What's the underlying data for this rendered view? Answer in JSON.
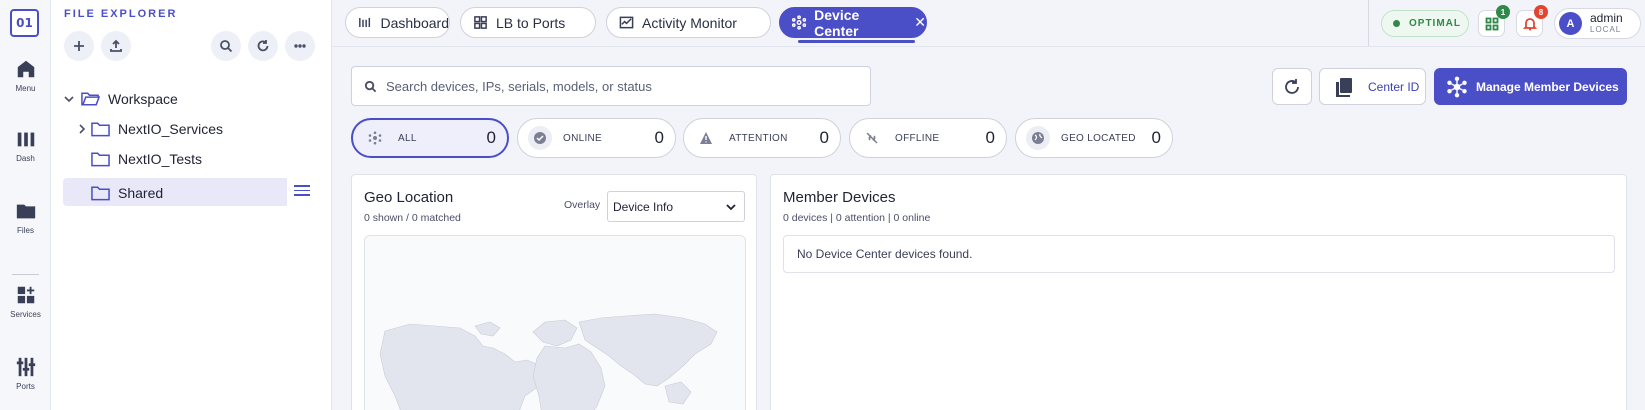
{
  "rail": {
    "logo": "01",
    "items": [
      {
        "label": "Menu",
        "icon": "home-icon"
      },
      {
        "label": "Dash",
        "icon": "bar-chart-icon"
      },
      {
        "label": "Files",
        "icon": "folder-icon"
      },
      {
        "label": "Services",
        "icon": "grid-plus-icon"
      },
      {
        "label": "Ports",
        "icon": "sliders-icon"
      }
    ]
  },
  "explorer": {
    "title": "FILE EXPLORER",
    "toolbar": [
      "plus-icon",
      "upload-icon",
      "search-icon",
      "refresh-icon",
      "more-icon"
    ],
    "tree": [
      {
        "label": "Workspace",
        "level": 0,
        "expanded": true
      },
      {
        "label": "NextIO_Services",
        "level": 1,
        "expanded": false
      },
      {
        "label": "NextIO_Tests",
        "level": 1
      },
      {
        "label": "Shared",
        "level": 1,
        "selected": true
      }
    ]
  },
  "tabs": [
    {
      "label": "Dashboard",
      "icon": "dashboard-icon"
    },
    {
      "label": "LB to Ports",
      "icon": "lb-icon"
    },
    {
      "label": "Activity Monitor",
      "icon": "activity-icon"
    },
    {
      "label": "Device Center",
      "icon": "device-hub-icon",
      "active": true,
      "close": "✕"
    }
  ],
  "header": {
    "status": "OPTIMAL",
    "apps_badge": "1",
    "notif_badge": "8",
    "user": {
      "initial": "A",
      "name": "admin",
      "role": "LOCAL"
    },
    "accent": "#4b4fc7",
    "status_color": "#2f8a49",
    "notif_color": "#e2452f"
  },
  "main": {
    "search_placeholder": "Search devices, IPs, serials, models, or status",
    "center_id_label": "Center ID",
    "manage_label": "Manage Member Devices",
    "filters": [
      {
        "label": "ALL",
        "count": "0",
        "icon": "hub-icon",
        "active": true
      },
      {
        "label": "ONLINE",
        "count": "0",
        "icon": "check-circle-icon"
      },
      {
        "label": "ATTENTION",
        "count": "0",
        "icon": "warning-icon"
      },
      {
        "label": "OFFLINE",
        "count": "0",
        "icon": "link-off-icon"
      },
      {
        "label": "GEO LOCATED",
        "count": "0",
        "icon": "globe-icon"
      }
    ],
    "geo": {
      "title": "Geo Location",
      "subtitle": "0 shown / 0 matched",
      "overlay_label": "Overlay",
      "overlay_value": "Device Info"
    },
    "members": {
      "title": "Member Devices",
      "subtitle": "0 devices | 0 attention | 0 online",
      "empty": "No Device Center devices found."
    }
  }
}
